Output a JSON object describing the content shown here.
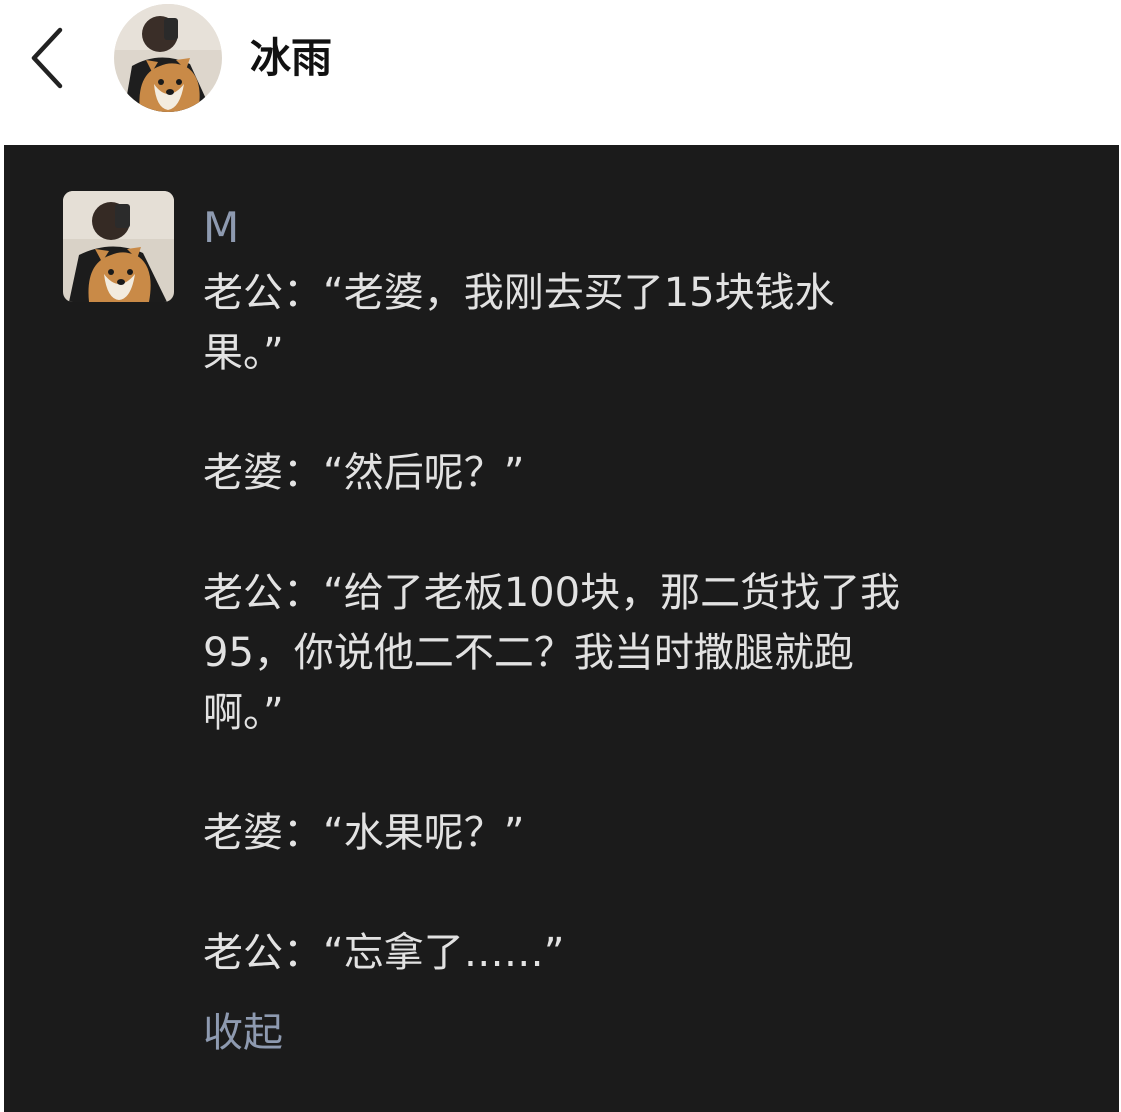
{
  "header": {
    "back_icon": "chevron-left-icon",
    "avatar_icon": "avatar-person-with-shiba-dog",
    "title": "冰雨"
  },
  "post": {
    "avatar_icon": "avatar-person-with-shiba-dog",
    "author": "M",
    "paragraphs": [
      "老公：“老婆，我刚去买了15块钱水\n果。”",
      "老婆：“然后呢？”",
      "老公：“给了老板100块，那二货找了我\n95，你说他二不二？我当时撒腿就跑\n啊。”",
      "老婆：“水果呢？”",
      "老公：“忘拿了……”"
    ],
    "collapse_label": "收起"
  },
  "colors": {
    "top_bg": "#ffffff",
    "title": "#111111",
    "content_bg": "#1b1b1b",
    "text": "#e2e2e2",
    "author": "#8e9ab0",
    "link": "#8e9ab0"
  }
}
